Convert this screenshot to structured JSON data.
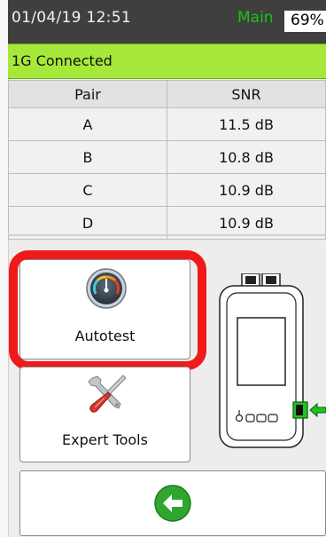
{
  "status": {
    "datetime": "01/04/19 12:51",
    "mode": "Main",
    "battery": "69%"
  },
  "connection": {
    "label": "1G Connected"
  },
  "table": {
    "headers": [
      "Pair",
      "SNR"
    ],
    "rows": [
      {
        "pair": "A",
        "snr": "11.5 dB"
      },
      {
        "pair": "B",
        "snr": "10.8 dB"
      },
      {
        "pair": "C",
        "snr": "10.9 dB"
      },
      {
        "pair": "D",
        "snr": "10.9 dB"
      }
    ]
  },
  "buttons": {
    "autotest": "Autotest",
    "expert_tools": "Expert Tools"
  },
  "colors": {
    "status_bar": "#3f3f3f",
    "mode": "#19c419",
    "banner": "#a5e83a",
    "highlight": "#f01a1a",
    "back": "#2fa72f"
  },
  "icons": {
    "autotest": "gauge-icon",
    "expert_tools": "wrench-screwdriver-icon",
    "back": "back-arrow-icon",
    "device": "tester-device-icon"
  }
}
